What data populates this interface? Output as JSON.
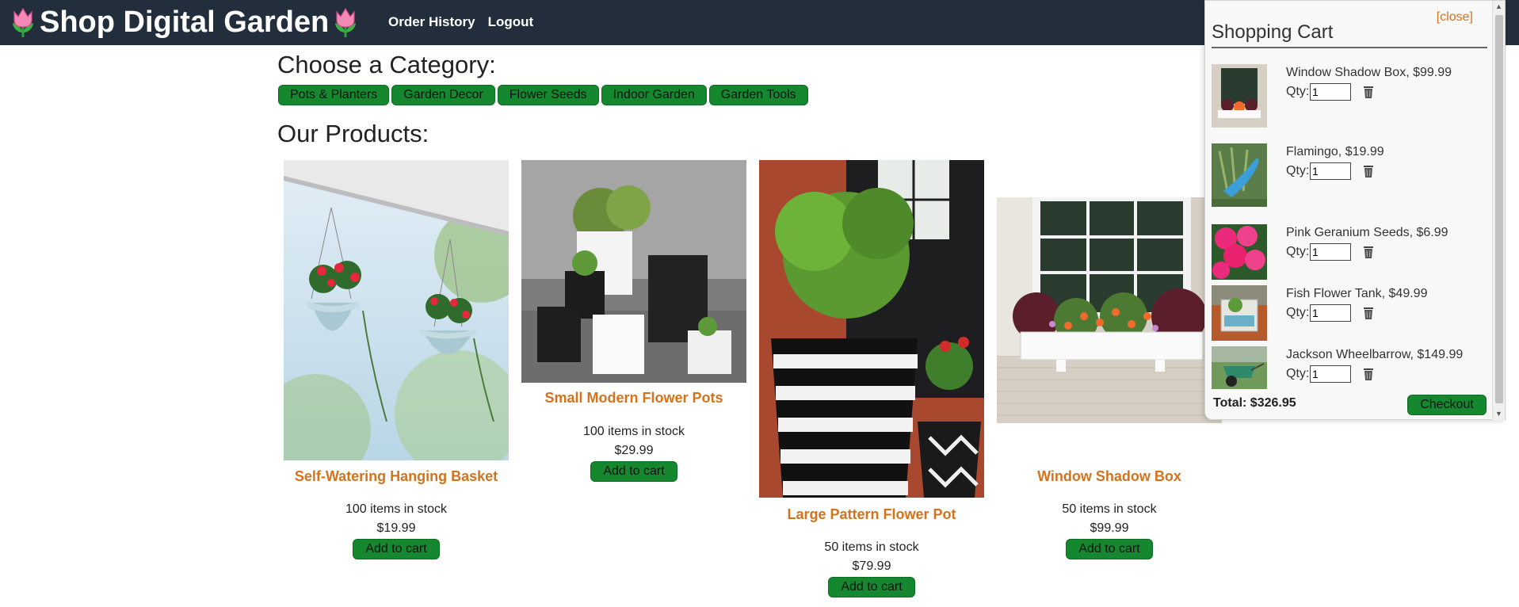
{
  "header": {
    "title": "Shop Digital Garden",
    "nav": [
      "Order History",
      "Logout"
    ]
  },
  "categories_title": "Choose a Category:",
  "categories": [
    "Pots & Planters",
    "Garden Decor",
    "Flower Seeds",
    "Indoor Garden",
    "Garden Tools"
  ],
  "products_title": "Our Products:",
  "products": [
    {
      "name": "Self-Watering Hanging Basket",
      "stock": "100 items in stock",
      "price": "$19.99",
      "button": "Add to cart"
    },
    {
      "name": "Small Modern Flower Pots",
      "stock": "100 items in stock",
      "price": "$29.99",
      "button": "Add to cart"
    },
    {
      "name": "Large Pattern Flower Pot",
      "stock": "50 items in stock",
      "price": "$79.99",
      "button": "Add to cart"
    },
    {
      "name": "Window Shadow Box",
      "stock": "50 items in stock",
      "price": "$99.99",
      "button": "Add to cart"
    }
  ],
  "cart": {
    "close": "[close]",
    "title": "Shopping Cart",
    "qty_label": "Qty:",
    "items": [
      {
        "name": "Window Shadow Box, $99.99",
        "qty": "1"
      },
      {
        "name": "Flamingo, $19.99",
        "qty": "1"
      },
      {
        "name": "Pink Geranium Seeds, $6.99",
        "qty": "1"
      },
      {
        "name": "Fish Flower Tank, $49.99",
        "qty": "1"
      },
      {
        "name": "Jackson Wheelbarrow, $149.99",
        "qty": "1"
      }
    ],
    "total": "Total: $326.95",
    "checkout": "Checkout"
  },
  "colors": {
    "header_bg": "#232e3c",
    "accent_green": "#15872f",
    "product_name": "#d4731e"
  }
}
